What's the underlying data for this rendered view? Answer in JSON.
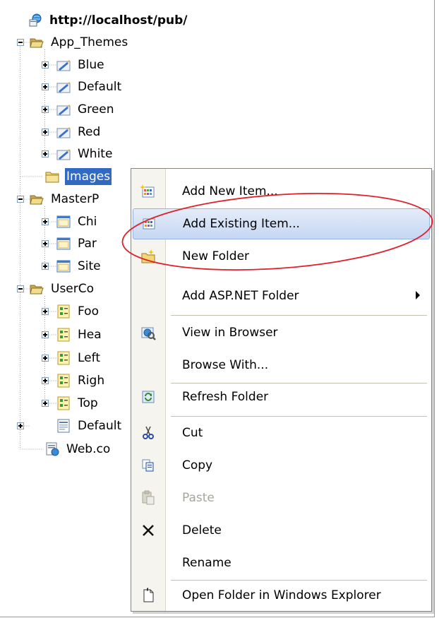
{
  "tree": {
    "root": "http://localhost/pub/",
    "nodes": [
      {
        "label": "App_Themes",
        "icon": "open-folder-icon"
      },
      {
        "label": "Blue",
        "icon": "theme-icon"
      },
      {
        "label": "Default",
        "icon": "theme-icon"
      },
      {
        "label": "Green",
        "icon": "theme-icon"
      },
      {
        "label": "Red",
        "icon": "theme-icon"
      },
      {
        "label": "White",
        "icon": "theme-icon"
      },
      {
        "label": "Images",
        "icon": "folder-icon"
      },
      {
        "label": "MasterP",
        "icon": "open-folder-icon"
      },
      {
        "label": "Chi",
        "icon": "master-page-icon"
      },
      {
        "label": "Par",
        "icon": "master-page-icon"
      },
      {
        "label": "Site",
        "icon": "master-page-icon"
      },
      {
        "label": "UserCo",
        "icon": "open-folder-icon"
      },
      {
        "label": "Foo",
        "icon": "user-control-icon"
      },
      {
        "label": "Hea",
        "icon": "user-control-icon"
      },
      {
        "label": "Left",
        "icon": "user-control-icon"
      },
      {
        "label": "Righ",
        "icon": "user-control-icon"
      },
      {
        "label": "Top",
        "icon": "user-control-icon"
      },
      {
        "label": "Default",
        "icon": "aspx-page-icon"
      },
      {
        "label": "Web.co",
        "icon": "config-file-icon"
      }
    ]
  },
  "context_menu": {
    "items": [
      {
        "label": "Add New Item...",
        "icon": "add-new-item-icon"
      },
      {
        "label": "Add Existing Item...",
        "icon": "add-existing-item-icon",
        "state": "hover"
      },
      {
        "label": "New Folder",
        "icon": "new-folder-icon"
      },
      {
        "label": "Add ASP.NET Folder",
        "icon": "",
        "submenu": true
      },
      {
        "label": "View in Browser",
        "icon": "view-in-browser-icon"
      },
      {
        "label": "Browse With...",
        "icon": ""
      },
      {
        "label": "Refresh Folder",
        "icon": "refresh-icon"
      },
      {
        "label": "Cut",
        "icon": "scissors-icon"
      },
      {
        "label": "Copy",
        "icon": "copy-icon"
      },
      {
        "label": "Paste",
        "icon": "paste-icon",
        "state": "disabled"
      },
      {
        "label": "Delete",
        "icon": "delete-icon"
      },
      {
        "label": "Rename",
        "icon": ""
      },
      {
        "label": "Open Folder in Windows Explorer",
        "icon": "open-in-explorer-icon"
      }
    ]
  },
  "colors": {
    "selection": "#316ac5",
    "menu_gutter": "#f5f4ee",
    "hover_fill": "#c6d7f3",
    "annotation_ellipse": "#e0202a"
  }
}
